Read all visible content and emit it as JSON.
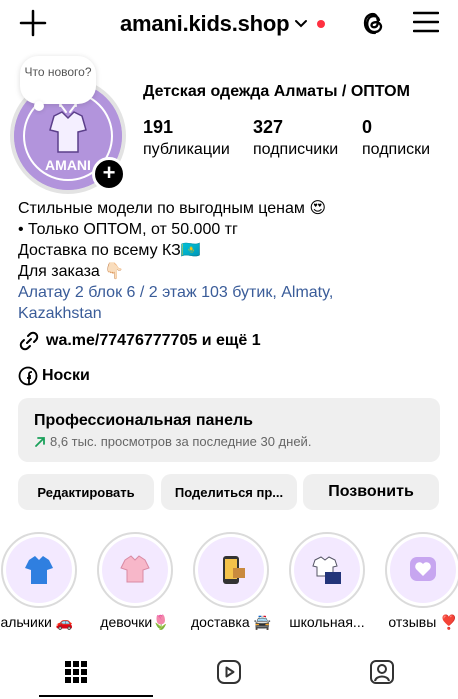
{
  "header": {
    "username": "amani.kids.shop",
    "icons": [
      "plus-icon",
      "chevron-down-icon",
      "threads-icon",
      "menu-icon"
    ],
    "notification_dot_color": "#ff3040"
  },
  "profile": {
    "note": "Что нового?",
    "full_name": "Детская одежда Алматы / ОПТОМ",
    "stats": [
      {
        "value": "191",
        "label": "публикации"
      },
      {
        "value": "327",
        "label": "подписчики"
      },
      {
        "value": "0",
        "label": "подписки"
      }
    ],
    "bio_lines": [
      "Стильные модели по выгодным ценам 😍",
      "• Только ОПТОМ, от 50.000 тг",
      "Доставка по всему КЗ🇰🇿",
      "Для заказа 👇🏻"
    ],
    "address_lines": [
      "Алатау 2 блок 6 / 2 этаж 103 бутик, Almaty,",
      "Kazakhstan"
    ],
    "link": "wa.me/77476777705 и ещё 1",
    "facebook_page": "Носки"
  },
  "pro_panel": {
    "title": "Профессиональная панель",
    "subtitle": "8,6 тыс. просмотров за последние 30 дней."
  },
  "buttons": {
    "edit": "Редактировать",
    "share": "Поделиться пр...",
    "call": "Позвонить"
  },
  "highlights": [
    {
      "label": "мальчики 🚗"
    },
    {
      "label": "девочки🌷"
    },
    {
      "label": "доставка 🚔"
    },
    {
      "label": "школьная..."
    },
    {
      "label": "отзывы ❣️"
    }
  ],
  "tabs": [
    "grid-icon",
    "reels-icon",
    "tagged-icon"
  ],
  "colors": {
    "address_link": "#3a5c99",
    "trend_arrow": "#1aa05a",
    "panel_bg": "#efefef"
  }
}
